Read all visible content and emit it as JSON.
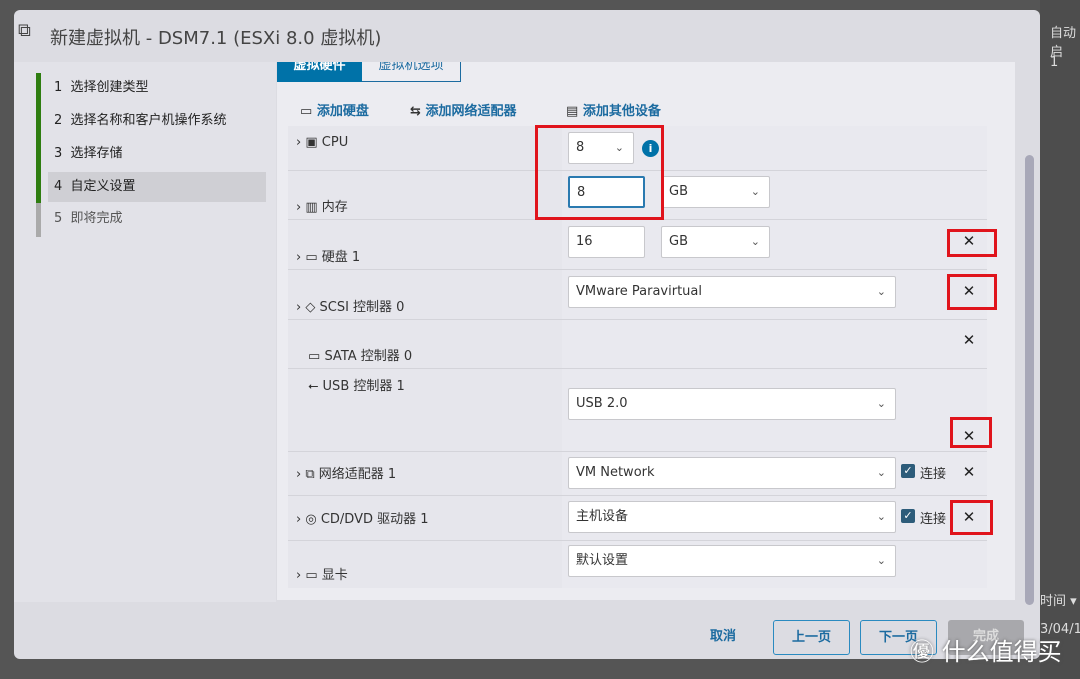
{
  "dialog": {
    "title": "新建虚拟机 - DSM7.1 (ESXi 8.0 虚拟机)"
  },
  "background": {
    "col_header": "自动启",
    "col_value": "1",
    "time_header": "时间 ▾",
    "date": "3/04/1"
  },
  "steps": [
    {
      "num": "1",
      "label": "选择创建类型"
    },
    {
      "num": "2",
      "label": "选择名称和客户机操作系统"
    },
    {
      "num": "3",
      "label": "选择存储"
    },
    {
      "num": "4",
      "label": "自定义设置"
    },
    {
      "num": "5",
      "label": "即将完成"
    }
  ],
  "tabs": {
    "hardware": "虚拟硬件",
    "options": "虚拟机选项"
  },
  "toolbar": {
    "add_disk": "添加硬盘",
    "add_nic": "添加网络适配器",
    "add_other": "添加其他设备"
  },
  "rows": {
    "cpu": {
      "label": "CPU",
      "value": "8"
    },
    "memory": {
      "label": "内存",
      "value": "8",
      "unit": "GB"
    },
    "disk": {
      "label": "硬盘 1",
      "value": "16",
      "unit": "GB"
    },
    "scsi": {
      "label": "SCSI 控制器 0",
      "value": "VMware Paravirtual"
    },
    "sata": {
      "label": "SATA 控制器 0"
    },
    "usb": {
      "label": "USB 控制器 1",
      "value": "USB 2.0"
    },
    "nic": {
      "label": "网络适配器 1",
      "value": "VM Network",
      "connect": "连接"
    },
    "cdrom": {
      "label": "CD/DVD 驱动器 1",
      "value": "主机设备",
      "connect": "连接"
    },
    "video": {
      "label": "显卡",
      "value": "默认设置"
    }
  },
  "footer": {
    "cancel": "取消",
    "back": "上一页",
    "next": "下一页",
    "finish": "完成"
  },
  "watermark": "什么值得买",
  "colors": {
    "accent": "#1c6ba0",
    "highlight": "#e0141c",
    "step_done": "#2e7d10",
    "tab_active": "#0072a8"
  }
}
